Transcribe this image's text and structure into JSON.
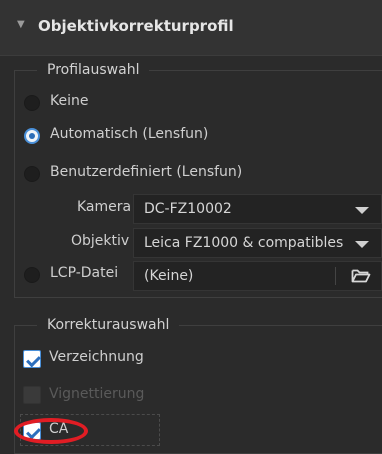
{
  "header": {
    "title": "Objektivkorrekturprofil"
  },
  "profile_group": {
    "legend": "Profilauswahl",
    "options": [
      {
        "label": "Keine",
        "selected": false
      },
      {
        "label": "Automatisch (Lensfun)",
        "selected": true
      },
      {
        "label": "Benutzerdefiniert (Lensfun)",
        "selected": false
      }
    ],
    "camera": {
      "label": "Kamera",
      "value": "DC-FZ10002"
    },
    "lens": {
      "label": "Objektiv",
      "value": "Leica FZ1000 & compatibles"
    },
    "lcp": {
      "label": "LCP-Datei",
      "value": "(Keine)",
      "selected": false
    }
  },
  "correction_group": {
    "legend": "Korrekturauswahl",
    "checks": [
      {
        "label": "Verzeichnung",
        "checked": true,
        "enabled": true
      },
      {
        "label": "Vignettierung",
        "checked": false,
        "enabled": false
      },
      {
        "label": "CA",
        "checked": true,
        "enabled": true
      }
    ]
  },
  "colors": {
    "accent": "#4a90d9",
    "highlight_ring": "#e11d24",
    "panel": "#2b2b2b"
  }
}
